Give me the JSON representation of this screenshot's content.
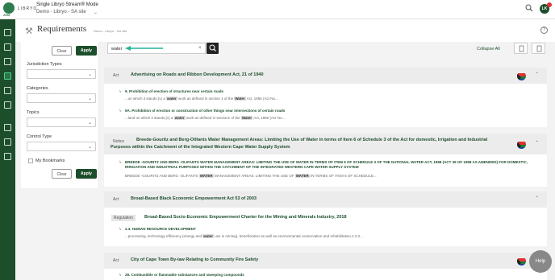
{
  "app": {
    "logo_sub": "ZEM",
    "brand": "LIBRYO",
    "mode_title": "Single Libryo Stream® Mode",
    "site": "Demo - Libryo - SA site",
    "avatar": "LK"
  },
  "page": {
    "title": "Requirements",
    "breadcrumb": "Demo - Libryo - SA site",
    "info": "?"
  },
  "filters": {
    "clear": "Clear",
    "apply": "Apply",
    "jurisdiction": "Jurisdiction Types",
    "categories": "Categories",
    "topics": "Topics",
    "control": "Control Type",
    "bookmarks": "My Bookmarks"
  },
  "search": {
    "value": "water",
    "clear": "×"
  },
  "toolbar": {
    "collapse": "Collapse All"
  },
  "results": [
    {
      "type": "Act",
      "title": "Advertising on Roads and Ribbon Development Act, 21 of 1940",
      "items": [
        {
          "section": "9. Prohibition of erection of structures near certain roads",
          "pre": "...on which it stands;(v) a ",
          "hl": "water",
          "mid": " work as defined in section 1 of the ",
          "hl2": "Water",
          "post": " Act, 1956 (Act No..."
        },
        {
          "section": "9A. Prohibition of erection or construction of other things near intersections of certain roads",
          "pre": "...land on which it stands;(v) a ",
          "hl": "water",
          "mid": " work as defined in section1 of the ",
          "hl2": "Water",
          "post": " Act, 1956 (Act No..."
        }
      ]
    },
    {
      "type": "Notice",
      "title": "Breede-Gouritz and Berg-Olifants Water Management Areas: Limiting the Use of Water in terms of Item 6 of Schedule 3 of the Act for domestic, Irrigation and Industrial Purposes within the Catchment of the Integrated Western Cape Water Supply System",
      "items": [
        {
          "section": "BREEDE -GOURITZ AND BERG -OLIFANTS WATER MANAGEMENT AREAS: LIMITING THE USE OF WATER IN TERMS OF ITEM 6 OF SCHEDULE 3 OF THE NATIONAL WATER ACT, 1998 (ACT 36 OF 1998 AS AMENDED) FOR DOMESTIC, IRRIGATION AND INDUSTRIAL PURPOSES WITHIN THE CATCHMENT OF THE INTEGRATED WESTERN CAPE WATER SUPPLY SYSTEM",
          "pre": "BREEDE -GOURITZ AND BERG -OLIFANTS ",
          "hl": "WATER",
          "mid": " MANAGEMENT AREAS: LIMITING THE USE OF ",
          "hl2": "WATER",
          "post": " IN TERMS OF ITEM 6 OF SCHEDULE..."
        }
      ]
    },
    {
      "type": "Act",
      "title": "Broad-Based Black Economic Empowerment Act 53 of 2003",
      "sub_type": "Regulation",
      "sub_title": "Broad-Based Socio-Economic Empowerment Charter for the Mining and Minerals Industry, 2018",
      "items": [
        {
          "section": "2.3. HUMAN RESOURCE DEVELOPMENT",
          "pre": "...processing, technology efficiency (energy and ",
          "hl": "water",
          "mid": " use in mining), beneficiation as well as environmental conservation and rehabilitation.2.3.2...",
          "hl2": "",
          "post": ""
        }
      ]
    },
    {
      "type": "Act",
      "title": "City of Cape Town By-law Relating to Community Fire Safety",
      "items": [
        {
          "section": "28. Combustible or flammable substances and sweeping compounds",
          "pre": "",
          "hl": "",
          "mid": "",
          "hl2": "",
          "post": ""
        }
      ]
    }
  ],
  "help": "Help",
  "colors": {
    "brand_green": "#1d4e2c",
    "accent_green": "#4fd08a",
    "arrow_teal": "#21b39a"
  }
}
